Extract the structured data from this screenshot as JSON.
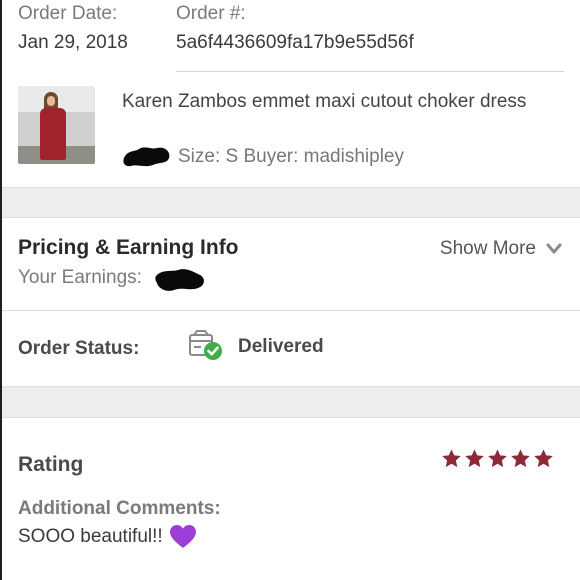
{
  "order": {
    "date_label": "Order Date:",
    "date_value": "Jan 29, 2018",
    "number_label": "Order #:",
    "number_value": "5a6f4436609fa17b9e55d56f"
  },
  "item": {
    "title": "Karen Zambos emmet maxi cutout choker dress",
    "meta": "Size: S  Buyer: madishipley"
  },
  "pricing": {
    "title": "Pricing & Earning Info",
    "earnings_label": "Your Earnings:",
    "show_more_label": "Show More",
    "show_more_icon": "chevron-down-icon"
  },
  "status": {
    "label": "Order Status:",
    "value": "Delivered",
    "icon": "package-delivered-icon"
  },
  "rating": {
    "title": "Rating",
    "stars": 5,
    "stars_max": 5,
    "comments_label": "Additional Comments:",
    "comments_text": "SOOO beautiful!!",
    "comments_emoji": "purple-heart-icon"
  },
  "colors": {
    "star": "#8c2a37",
    "check_green": "#3fae49",
    "heart_purple": "#9b3fd6",
    "separator": "#eeedeb"
  }
}
